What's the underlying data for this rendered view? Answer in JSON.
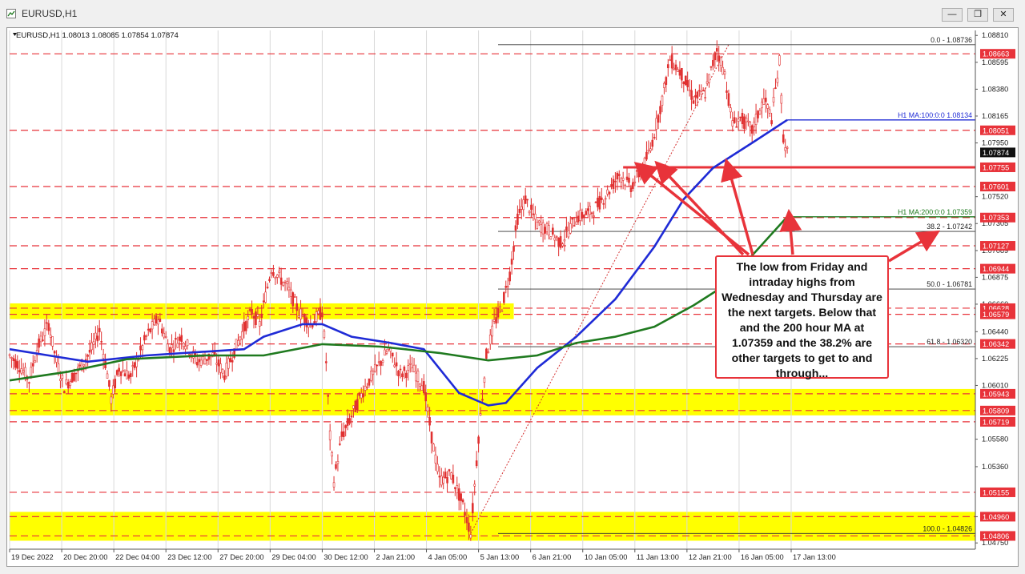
{
  "window": {
    "title": "EURUSD,H1",
    "controls": [
      "minimize-icon",
      "restore-icon",
      "close-icon"
    ]
  },
  "colors": {
    "background": "#ffffff",
    "grid": "#d9d9d9",
    "candle": "#e03030",
    "resistance_line": "#e8333a",
    "ma100": "#1f2bd6",
    "ma200": "#1f7a1f",
    "fib": "#333333",
    "zone": "#ffff00",
    "price_tag": "#e8333a",
    "current_price_tag": "#111111"
  },
  "chart_data": {
    "type": "candlestick",
    "symbol": "EURUSD",
    "timeframe": "H1",
    "ohlc_header": "EURUSD,H1  1.08013 1.08085 1.07854 1.07874",
    "ylim": [
      1.047,
      1.0885
    ],
    "x_tick_labels": [
      "19 Dec 2022",
      "20 Dec 20:00",
      "22 Dec 04:00",
      "23 Dec 12:00",
      "27 Dec 20:00",
      "29 Dec 04:00",
      "30 Dec 12:00",
      "2 Jan 21:00",
      "4 Jan 05:00",
      "5 Jan 13:00",
      "6 Jan 21:00",
      "10 Jan 05:00",
      "11 Jan 13:00",
      "12 Jan 21:00",
      "16 Jan 05:00",
      "17 Jan 13:00"
    ],
    "y_tick_labels": [
      "1.08810",
      "1.08595",
      "1.08380",
      "1.08165",
      "1.07950",
      "1.07520",
      "1.07305",
      "1.07089",
      "1.06875",
      "1.06660",
      "1.06440",
      "1.06225",
      "1.06010",
      "1.05580",
      "1.05360",
      "1.04960",
      "1.04750"
    ],
    "price_tags": [
      "1.08663",
      "1.08051",
      "1.07874",
      "1.07755",
      "1.07601",
      "1.07353",
      "1.07127",
      "1.06944",
      "1.06628",
      "1.06579",
      "1.06342",
      "1.05943",
      "1.05809",
      "1.05719",
      "1.05155",
      "1.04960",
      "1.04806"
    ],
    "horizontal_levels": [
      1.08663,
      1.08051,
      1.07755,
      1.07601,
      1.07353,
      1.07127,
      1.06944,
      1.06628,
      1.06579,
      1.06342,
      1.05943,
      1.05809,
      1.05719,
      1.05155,
      1.0496,
      1.04806
    ],
    "highlight_zones": [
      {
        "from": 1.06579,
        "to": 1.06628
      },
      {
        "from": 1.05809,
        "to": 1.05943
      },
      {
        "from": 1.04806,
        "to": 1.0496
      }
    ],
    "key_level": 1.07755,
    "price_path": [
      {
        "t": 0,
        "v": 1.0625
      },
      {
        "t": 6,
        "v": 1.0615
      },
      {
        "t": 10,
        "v": 1.0605
      },
      {
        "t": 14,
        "v": 1.063
      },
      {
        "t": 20,
        "v": 1.065
      },
      {
        "t": 24,
        "v": 1.062
      },
      {
        "t": 28,
        "v": 1.06
      },
      {
        "t": 36,
        "v": 1.0615
      },
      {
        "t": 42,
        "v": 1.063
      },
      {
        "t": 46,
        "v": 1.0645
      },
      {
        "t": 50,
        "v": 1.061
      },
      {
        "t": 52,
        "v": 1.059
      },
      {
        "t": 56,
        "v": 1.0615
      },
      {
        "t": 62,
        "v": 1.0608
      },
      {
        "t": 70,
        "v": 1.064
      },
      {
        "t": 76,
        "v": 1.0655
      },
      {
        "t": 82,
        "v": 1.063
      },
      {
        "t": 88,
        "v": 1.064
      },
      {
        "t": 96,
        "v": 1.062
      },
      {
        "t": 104,
        "v": 1.0625
      },
      {
        "t": 110,
        "v": 1.061
      },
      {
        "t": 118,
        "v": 1.064
      },
      {
        "t": 124,
        "v": 1.066
      },
      {
        "t": 128,
        "v": 1.065
      },
      {
        "t": 134,
        "v": 1.0695
      },
      {
        "t": 142,
        "v": 1.068
      },
      {
        "t": 148,
        "v": 1.066
      },
      {
        "t": 154,
        "v": 1.065
      },
      {
        "t": 160,
        "v": 1.066
      },
      {
        "t": 162,
        "v": 1.062
      },
      {
        "t": 164,
        "v": 1.056
      },
      {
        "t": 166,
        "v": 1.0525
      },
      {
        "t": 170,
        "v": 1.056
      },
      {
        "t": 176,
        "v": 1.058
      },
      {
        "t": 182,
        "v": 1.06
      },
      {
        "t": 188,
        "v": 1.0615
      },
      {
        "t": 194,
        "v": 1.063
      },
      {
        "t": 200,
        "v": 1.061
      },
      {
        "t": 206,
        "v": 1.0615
      },
      {
        "t": 212,
        "v": 1.06
      },
      {
        "t": 216,
        "v": 1.056
      },
      {
        "t": 220,
        "v": 1.0525
      },
      {
        "t": 226,
        "v": 1.053
      },
      {
        "t": 232,
        "v": 1.0505
      },
      {
        "t": 236,
        "v": 1.0483
      },
      {
        "t": 240,
        "v": 1.056
      },
      {
        "t": 244,
        "v": 1.0625
      },
      {
        "t": 248,
        "v": 1.065
      },
      {
        "t": 252,
        "v": 1.0665
      },
      {
        "t": 256,
        "v": 1.069
      },
      {
        "t": 260,
        "v": 1.0735
      },
      {
        "t": 264,
        "v": 1.075
      },
      {
        "t": 270,
        "v": 1.073
      },
      {
        "t": 276,
        "v": 1.0725
      },
      {
        "t": 282,
        "v": 1.0715
      },
      {
        "t": 290,
        "v": 1.0735
      },
      {
        "t": 298,
        "v": 1.074
      },
      {
        "t": 306,
        "v": 1.0755
      },
      {
        "t": 312,
        "v": 1.077
      },
      {
        "t": 318,
        "v": 1.076
      },
      {
        "t": 324,
        "v": 1.0775
      },
      {
        "t": 328,
        "v": 1.079
      },
      {
        "t": 334,
        "v": 1.083
      },
      {
        "t": 338,
        "v": 1.0862
      },
      {
        "t": 344,
        "v": 1.085
      },
      {
        "t": 350,
        "v": 1.083
      },
      {
        "t": 356,
        "v": 1.0835
      },
      {
        "t": 362,
        "v": 1.087
      },
      {
        "t": 366,
        "v": 1.085
      },
      {
        "t": 370,
        "v": 1.081
      },
      {
        "t": 374,
        "v": 1.0815
      },
      {
        "t": 380,
        "v": 1.0805
      },
      {
        "t": 386,
        "v": 1.083
      },
      {
        "t": 390,
        "v": 1.0815
      },
      {
        "t": 394,
        "v": 1.086
      },
      {
        "t": 396,
        "v": 1.08
      },
      {
        "t": 398,
        "v": 1.0787
      }
    ],
    "t_max": 400,
    "moving_averages": [
      {
        "name": "H1 MA:100:0:0",
        "value_label": "1.08134",
        "path": [
          {
            "t": 0,
            "v": 1.063
          },
          {
            "t": 20,
            "v": 1.0625
          },
          {
            "t": 40,
            "v": 1.062
          },
          {
            "t": 70,
            "v": 1.0625
          },
          {
            "t": 100,
            "v": 1.0628
          },
          {
            "t": 120,
            "v": 1.063
          },
          {
            "t": 130,
            "v": 1.064
          },
          {
            "t": 150,
            "v": 1.065
          },
          {
            "t": 160,
            "v": 1.065
          },
          {
            "t": 175,
            "v": 1.064
          },
          {
            "t": 195,
            "v": 1.0635
          },
          {
            "t": 212,
            "v": 1.063
          },
          {
            "t": 230,
            "v": 1.0595
          },
          {
            "t": 245,
            "v": 1.0585
          },
          {
            "t": 254,
            "v": 1.0587
          },
          {
            "t": 270,
            "v": 1.0615
          },
          {
            "t": 290,
            "v": 1.064
          },
          {
            "t": 310,
            "v": 1.067
          },
          {
            "t": 330,
            "v": 1.0712
          },
          {
            "t": 345,
            "v": 1.075
          },
          {
            "t": 360,
            "v": 1.0775
          },
          {
            "t": 380,
            "v": 1.0795
          },
          {
            "t": 398,
            "v": 1.08134
          }
        ]
      },
      {
        "name": "H1 MA:200:0:0",
        "value_label": "1.07359",
        "path": [
          {
            "t": 0,
            "v": 1.0605
          },
          {
            "t": 30,
            "v": 1.0612
          },
          {
            "t": 60,
            "v": 1.0622
          },
          {
            "t": 100,
            "v": 1.0625
          },
          {
            "t": 130,
            "v": 1.0625
          },
          {
            "t": 160,
            "v": 1.0634
          },
          {
            "t": 190,
            "v": 1.0632
          },
          {
            "t": 220,
            "v": 1.0627
          },
          {
            "t": 245,
            "v": 1.0621
          },
          {
            "t": 270,
            "v": 1.0625
          },
          {
            "t": 290,
            "v": 1.0635
          },
          {
            "t": 310,
            "v": 1.064
          },
          {
            "t": 330,
            "v": 1.0648
          },
          {
            "t": 350,
            "v": 1.0665
          },
          {
            "t": 365,
            "v": 1.068
          },
          {
            "t": 380,
            "v": 1.0705
          },
          {
            "t": 398,
            "v": 1.07359
          }
        ]
      }
    ],
    "fibonacci": {
      "low": 1.04826,
      "high": 1.08736,
      "levels": [
        {
          "label": "0.0 - 1.08736",
          "value": 1.08736
        },
        {
          "label": "38.2 - 1.07242",
          "value": 1.07242
        },
        {
          "label": "50.0 - 1.06781",
          "value": 1.06781
        },
        {
          "label": "61.8 - 1.06320",
          "value": 1.0632
        },
        {
          "label": "100.0 - 1.04826",
          "value": 1.04826
        }
      ]
    },
    "annotation": "The low from Friday and intraday highs from Wednesday and Thursday are the next targets.  Below that and the 200 hour MA at 1.07359 and the 38.2% are other targets to get to and through...",
    "current_price": "1.07874"
  }
}
